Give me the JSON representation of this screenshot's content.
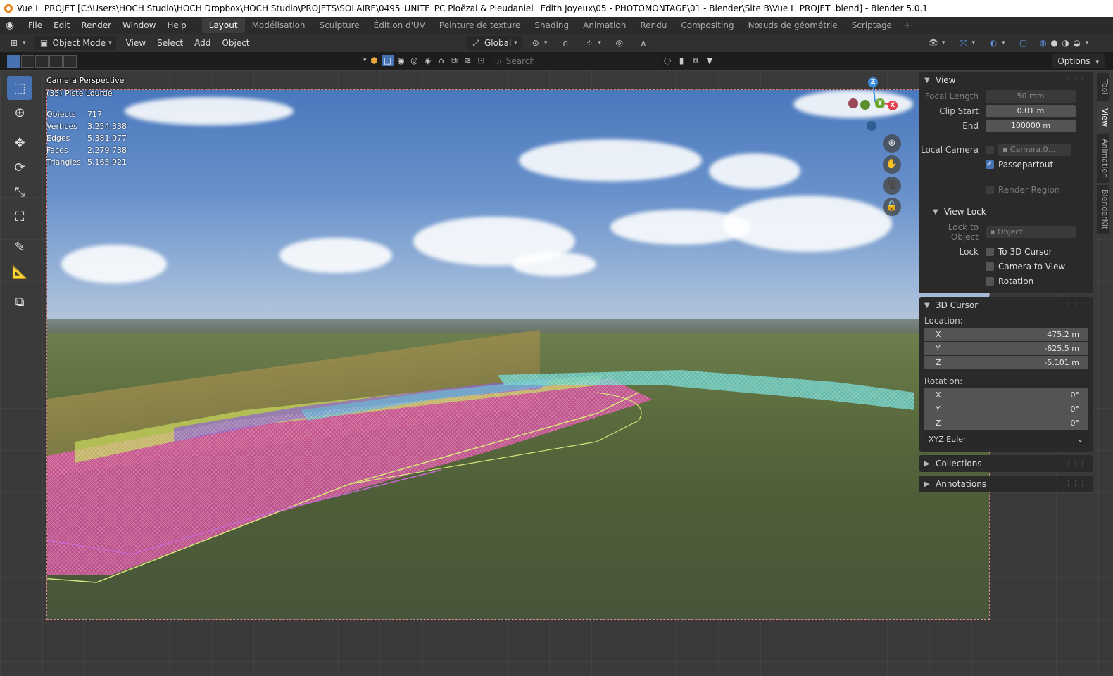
{
  "window": {
    "title": "Vue L_PROJET  [C:\\Users\\HOCH Studio\\HOCH Dropbox\\HOCH Studio\\PROJETS\\SOLAIRE\\0495_UNITE_PC Ploëzal & Pleudaniel _Edith Joyeux\\05 - PHOTOMONTAGE\\01 - Blender\\Site B\\Vue L_PROJET .blend] - Blender 5.0.1"
  },
  "menu": {
    "items": [
      "File",
      "Edit",
      "Render",
      "Window",
      "Help"
    ]
  },
  "workspaces": {
    "tabs": [
      "Layout",
      "Modélisation",
      "Sculpture",
      "Édition d'UV",
      "Peinture de texture",
      "Shading",
      "Animation",
      "Rendu",
      "Compositing",
      "Nœuds de géométrie",
      "Scriptage"
    ],
    "active": "Layout",
    "add": "+"
  },
  "header": {
    "mode": "Object Mode",
    "view": "View",
    "select": "Select",
    "add": "Add",
    "object": "Object",
    "orientation": "Global",
    "search_placeholder": "Search",
    "options": "Options"
  },
  "viewport": {
    "view_name": "Camera Perspective",
    "collection": "(35) Piste Lourde",
    "stats": [
      {
        "label": "Objects",
        "value": "717"
      },
      {
        "label": "Vertices",
        "value": "3,254,338"
      },
      {
        "label": "Edges",
        "value": "5,381,077"
      },
      {
        "label": "Faces",
        "value": "2,279,738"
      },
      {
        "label": "Triangles",
        "value": "5,165,921"
      }
    ]
  },
  "gizmo": {
    "x": "X",
    "y": "Y",
    "z": "Z"
  },
  "sidebar_tabs": [
    "Tool",
    "View",
    "Animation",
    "BlenderKit"
  ],
  "view_panel": {
    "title": "View",
    "focal_length_label": "Focal Length",
    "focal_length_value": "50 mm",
    "clip_start_label": "Clip Start",
    "clip_start_value": "0.01 m",
    "clip_end_label": "End",
    "clip_end_value": "100000 m",
    "local_camera_label": "Local Camera",
    "local_camera_value": "Camera.0...",
    "passepartout_label": "Passepartout",
    "render_region_label": "Render Region"
  },
  "view_lock": {
    "title": "View Lock",
    "lock_to_object_label": "Lock to Object",
    "lock_to_object_placeholder": "Object",
    "lock_label": "Lock",
    "to_3d_cursor": "To 3D Cursor",
    "camera_to_view": "Camera to View",
    "rotation": "Rotation"
  },
  "cursor_panel": {
    "title": "3D Cursor",
    "location_label": "Location:",
    "location": [
      {
        "axis": "X",
        "value": "475.2 m"
      },
      {
        "axis": "Y",
        "value": "-625.5 m"
      },
      {
        "axis": "Z",
        "value": "-5.101 m"
      }
    ],
    "rotation_label": "Rotation:",
    "rotation": [
      {
        "axis": "X",
        "value": "0°"
      },
      {
        "axis": "Y",
        "value": "0°"
      },
      {
        "axis": "Z",
        "value": "0°"
      }
    ],
    "rotation_mode": "XYZ Euler"
  },
  "collapsed_panels": [
    "Collections",
    "Annotations"
  ],
  "colors": {
    "accent": "#4772b3",
    "x_axis": "#e2414d",
    "y_axis": "#6ba832",
    "z_axis": "#3d8ee0",
    "frame_border": "#e08a8a"
  }
}
